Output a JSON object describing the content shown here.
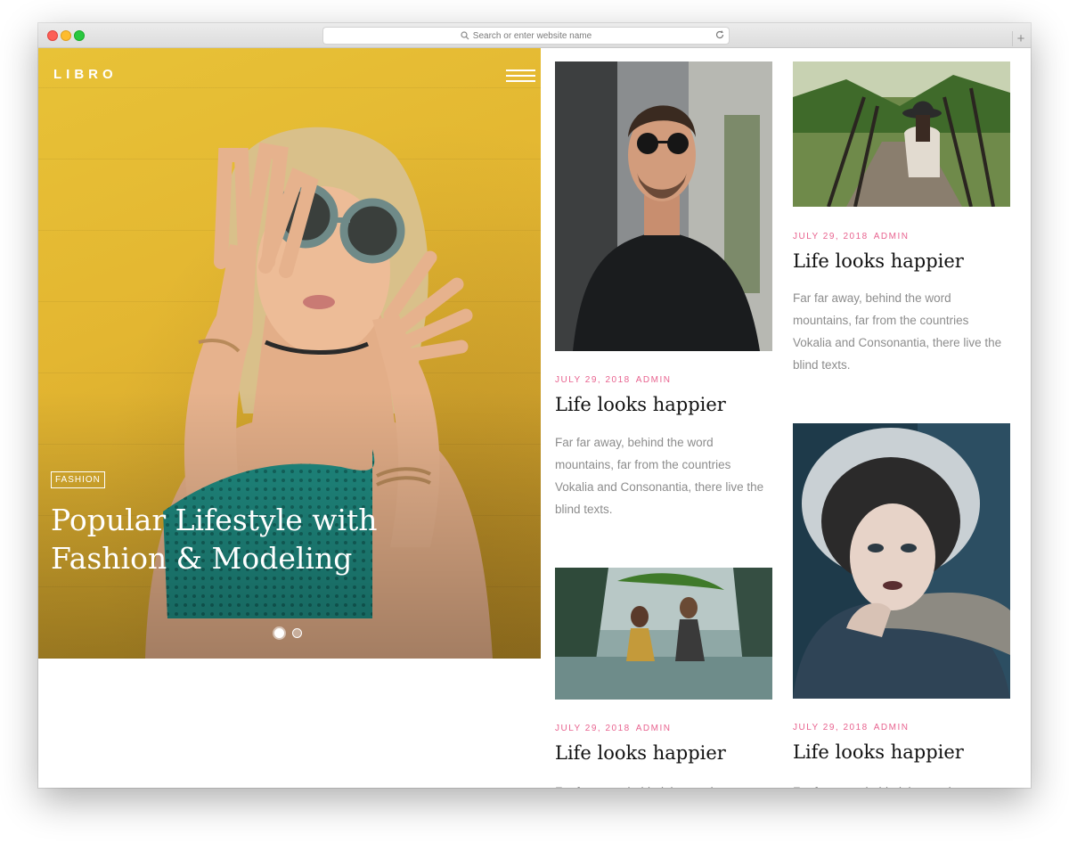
{
  "browser": {
    "address_placeholder": "Search or enter website name",
    "new_tab": "+"
  },
  "site": {
    "logo": "LIBRO"
  },
  "hero": {
    "tag": "FASHION",
    "title": "Popular Lifestyle with Fashion & Modeling",
    "slide_count": 2,
    "active_slide": 1
  },
  "posts": [
    {
      "date": "JULY 29, 2018",
      "author": "ADMIN",
      "title": "Life looks happier",
      "excerpt": "Far far away, behind the word mountains, far from the countries Vokalia and Consonantia, there live the blind texts."
    },
    {
      "date": "JULY 29, 2018",
      "author": "ADMIN",
      "title": "Life looks happier",
      "excerpt": "Far far away, behind the word mountains, far from the countries Vokalia and Consonantia, there live the blind texts."
    },
    {
      "date": "JULY 29, 2018",
      "author": "ADMIN",
      "title": "Life looks happier",
      "excerpt": "Far far away, behind the word"
    },
    {
      "date": "JULY 29, 2018",
      "author": "ADMIN",
      "title": "Life looks happier",
      "excerpt": "Far far away, behind the word"
    }
  ],
  "colors": {
    "accent": "#e8638f",
    "hero_background": "#e3b631",
    "excerpt_text": "#8d8d8d"
  }
}
